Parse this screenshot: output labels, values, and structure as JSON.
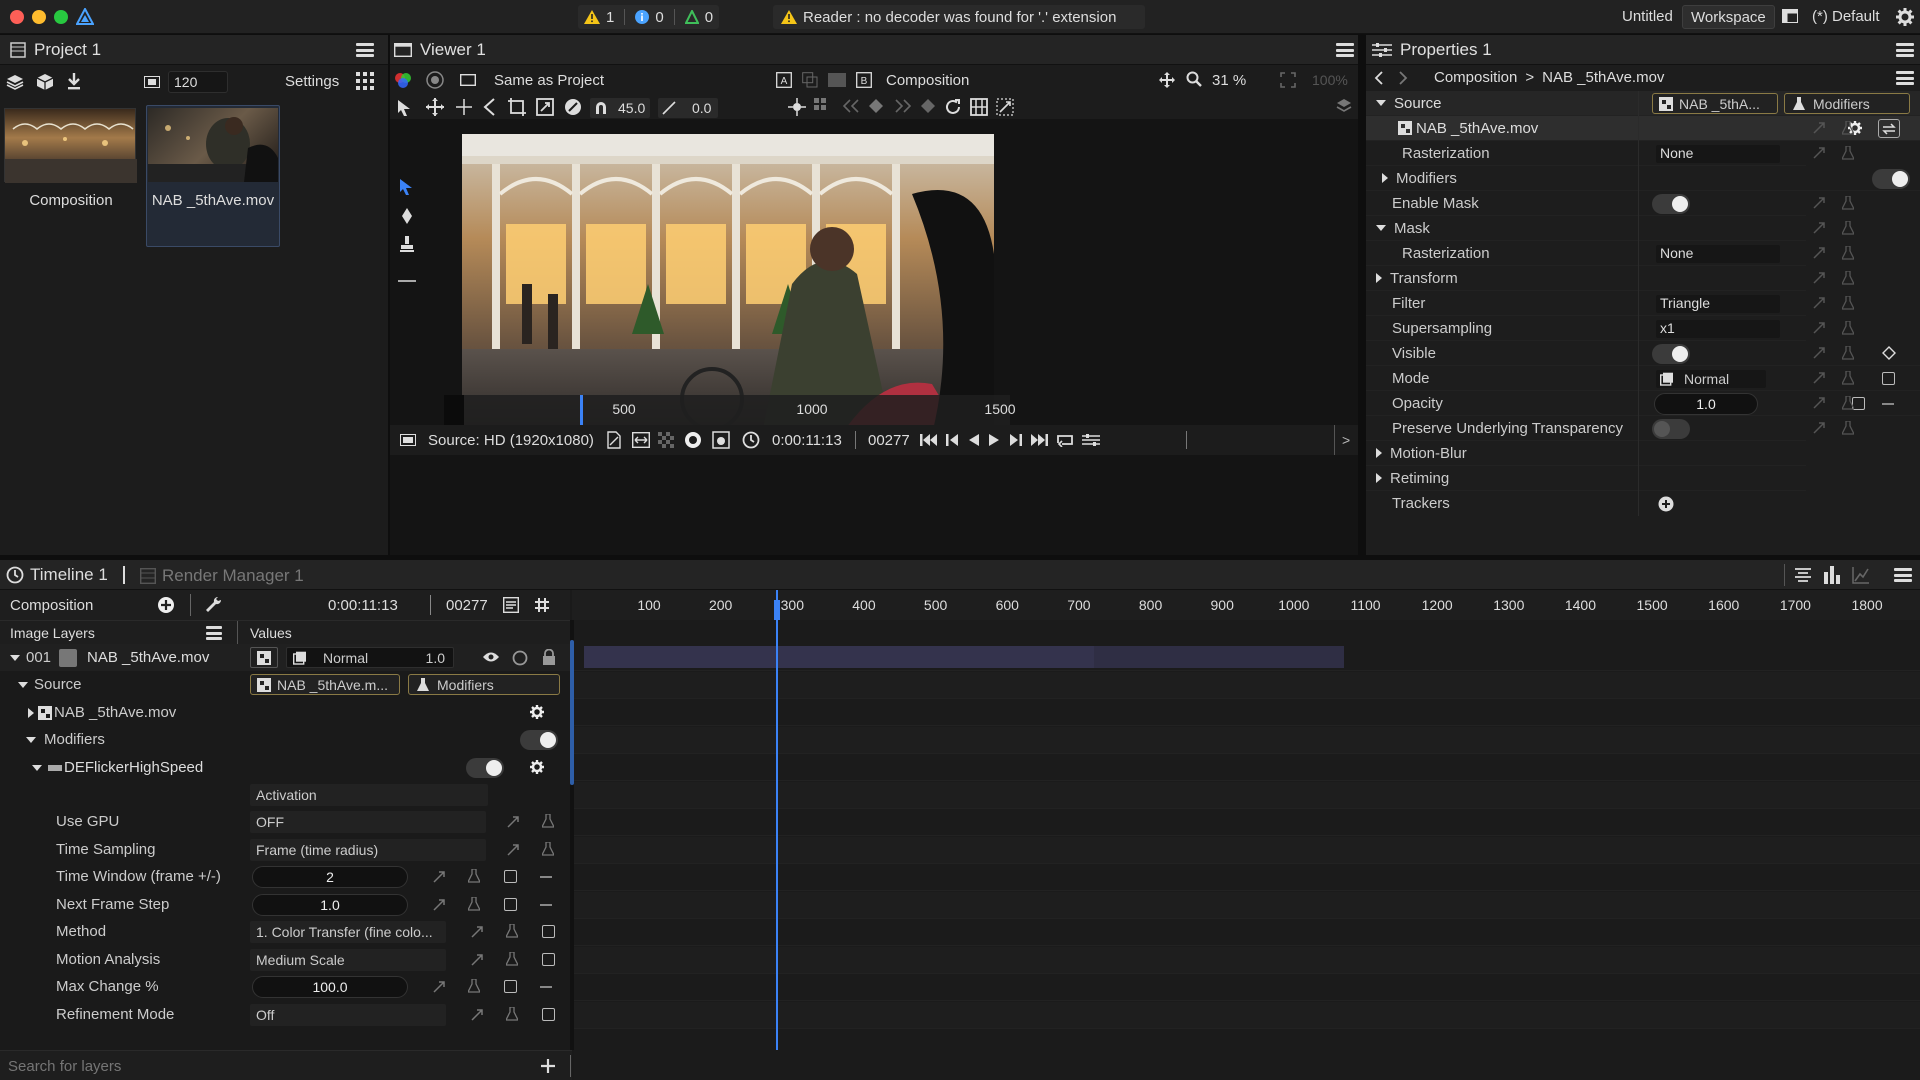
{
  "titlebar": {
    "warnings_count": "1",
    "info_count": "0",
    "tips_count": "0",
    "message": "Reader : no decoder was found for '.' extension",
    "doc_title": "Untitled",
    "workspace_label": "Workspace",
    "layout_label": "(*) Default"
  },
  "project": {
    "title": "Project 1",
    "fps_value": "120",
    "settings_label": "Settings",
    "items": [
      {
        "label": "Composition"
      },
      {
        "label": "NAB _5thAve.mov"
      }
    ]
  },
  "viewer": {
    "title": "Viewer 1",
    "same_as_project": "Same as Project",
    "composition_label": "Composition",
    "zoom": "31 %",
    "zoom_100": "100%",
    "angle_value": "45.0",
    "offset_value": "0.0",
    "ruler_ticks": [
      "500",
      "1000",
      "1500"
    ],
    "source_label": "Source: HD (1920x1080)",
    "timecode": "0:00:11:13",
    "frame": "00277",
    "more": ">"
  },
  "properties": {
    "title": "Properties 1",
    "breadcrumb_root": "Composition",
    "breadcrumb_sep": ">",
    "breadcrumb_leaf": "NAB _5thAve.mov",
    "source_chip": "NAB _5thA...",
    "modifiers_chip": "Modifiers",
    "rows": {
      "source": "Source",
      "file": "NAB _5thAve.mov",
      "rasterization": "Rasterization",
      "rasterization_value": "None",
      "modifiers": "Modifiers",
      "enable_mask": "Enable Mask",
      "mask": "Mask",
      "mask_rasterization": "Rasterization",
      "mask_rasterization_value": "None",
      "transform": "Transform",
      "filter": "Filter",
      "filter_value": "Triangle",
      "supersampling": "Supersampling",
      "supersampling_value": "x1",
      "visible": "Visible",
      "mode": "Mode",
      "mode_value": "Normal",
      "opacity": "Opacity",
      "opacity_value": "1.0",
      "preserve": "Preserve Underlying Transparency",
      "motion_blur": "Motion-Blur",
      "retiming": "Retiming",
      "trackers": "Trackers"
    }
  },
  "timeline": {
    "tab_timeline": "Timeline 1",
    "tab_render": "Render Manager 1",
    "comp_label": "Composition",
    "timecode": "0:00:11:13",
    "frame": "00277",
    "image_layers": "Image Layers",
    "values": "Values",
    "ruler_ticks": [
      "100",
      "200",
      "300",
      "400",
      "500",
      "600",
      "700",
      "800",
      "900",
      "1000",
      "1100",
      "1200",
      "1300",
      "1400",
      "1500",
      "1600",
      "1700",
      "1800"
    ],
    "playhead_frame": 277,
    "search_placeholder": "Search for layers",
    "layer": {
      "index": "001",
      "name": "NAB _5thAve.mov",
      "blend": "Normal",
      "opacity": "1.0",
      "source": "Source",
      "source_chip": "NAB _5thAve.m...",
      "modifiers_chip": "Modifiers",
      "file": "NAB _5thAve.mov",
      "modifiers": "Modifiers",
      "effect": "DEFlickerHighSpeed",
      "activation": "Activation",
      "params": [
        {
          "label": "Use GPU",
          "value": "OFF"
        },
        {
          "label": "Time Sampling",
          "value": "Frame (time radius)"
        },
        {
          "label": "Time Window (frame +/-)",
          "value": "2"
        },
        {
          "label": "Next Frame Step",
          "value": "1.0"
        },
        {
          "label": "Method",
          "value": "1. Color Transfer (fine colo..."
        },
        {
          "label": "Motion Analysis",
          "value": "Medium  Scale"
        },
        {
          "label": "Max Change %",
          "value": "100.0"
        },
        {
          "label": "Refinement Mode",
          "value": "Off"
        }
      ]
    }
  },
  "colors": {
    "accent_blue": "#3b82f6",
    "warning": "#f5c518",
    "clip_bar": "#34334d",
    "toggle_on": "#f2f2f2"
  }
}
